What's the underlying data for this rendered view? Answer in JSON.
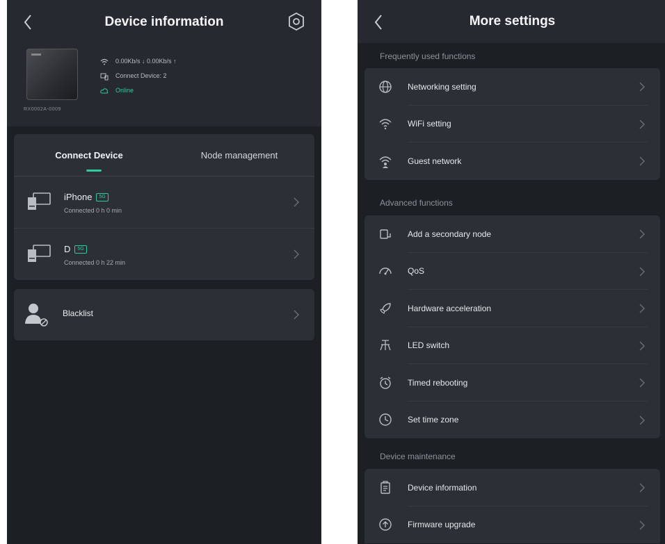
{
  "left": {
    "title": "Device information",
    "device": {
      "id": "RX0002A-0009",
      "speed": "0.00Kb/s ↓  0.00Kb/s ↑",
      "connect_device": "Connect Device: 2",
      "status": "Online"
    },
    "tabs": [
      {
        "label": "Connect Device"
      },
      {
        "label": "Node management"
      }
    ],
    "devices": [
      {
        "name": "iPhone",
        "badge": "5G",
        "connected": "Connected 0 h 0 min"
      },
      {
        "name": "D",
        "badge": "5G",
        "connected": "Connected 0 h 22 min"
      }
    ],
    "blacklist_label": "Blacklist"
  },
  "right": {
    "title": "More settings",
    "sections": [
      {
        "title": "Frequently used functions",
        "items": [
          {
            "label": "Networking setting",
            "icon": "globe-icon"
          },
          {
            "label": "WiFi setting",
            "icon": "wifi-icon"
          },
          {
            "label": "Guest network",
            "icon": "guest-wifi-icon"
          }
        ]
      },
      {
        "title": "Advanced functions",
        "items": [
          {
            "label": "Add a secondary node",
            "icon": "node-icon"
          },
          {
            "label": "QoS",
            "icon": "qos-icon"
          },
          {
            "label": "Hardware acceleration",
            "icon": "rocket-icon"
          },
          {
            "label": "LED switch",
            "icon": "led-icon"
          },
          {
            "label": "Timed rebooting",
            "icon": "alarm-icon"
          },
          {
            "label": "Set time zone",
            "icon": "clock-icon"
          }
        ]
      },
      {
        "title": "Device maintenance",
        "items": [
          {
            "label": "Device information",
            "icon": "device-info-icon"
          },
          {
            "label": "Firmware upgrade",
            "icon": "upgrade-icon"
          }
        ]
      }
    ]
  },
  "colors": {
    "accent": "#2ecc9a",
    "background": "#1c1f24",
    "card": "#2b2f36"
  }
}
